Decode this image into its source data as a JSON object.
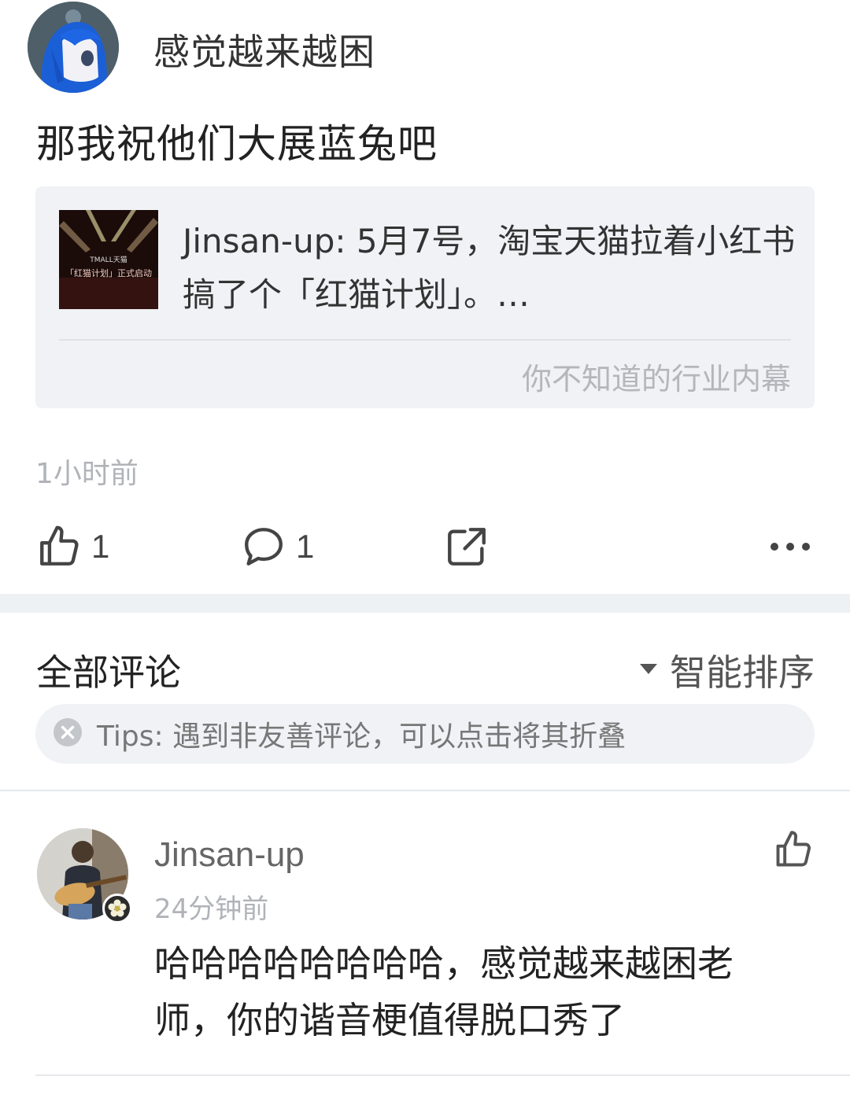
{
  "post": {
    "author": "感觉越来越困",
    "text": "那我祝他们大展蓝兔吧",
    "quote": {
      "text": "Jinsan-up: 5月7号，淘宝天猫拉着小红书搞了个「红猫计划」。…",
      "source": "你不知道的行业内幕",
      "thumb_caption": "「红猫计划」正式启动",
      "thumb_brand": "TMALL天猫"
    },
    "time": "1小时前",
    "actions": {
      "like_count": "1",
      "comment_count": "1"
    }
  },
  "comments_section": {
    "title": "全部评论",
    "sort_label": "智能排序",
    "tips": "Tips: 遇到非友善评论，可以点击将其折叠"
  },
  "comments": [
    {
      "author": "Jinsan-up",
      "time": "24分钟前",
      "text": "哈哈哈哈哈哈哈哈，感觉越来越困老师，你的谐音梗值得脱口秀了"
    }
  ],
  "colors": {
    "background": "#ffffff",
    "card": "#f0f2f5",
    "divider": "#e6e8eb",
    "muted_text": "#b0b3b8"
  },
  "icons": [
    "thumbs-up-icon",
    "comment-bubble-icon",
    "share-icon",
    "more-dots-icon",
    "sort-caret-icon",
    "close-circle-icon",
    "flower-badge-icon"
  ]
}
